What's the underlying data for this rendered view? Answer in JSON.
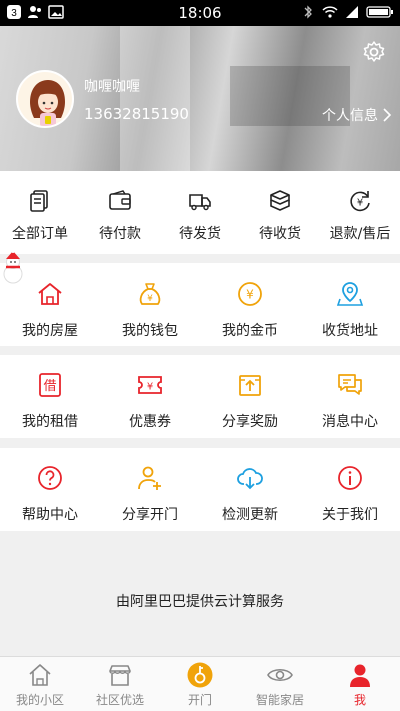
{
  "statusbar": {
    "time": "18:06",
    "notif_count": "3"
  },
  "header": {
    "username": "咖喱咖喱",
    "phone": "13632815190",
    "profile_link": "个人信息"
  },
  "orders": [
    {
      "label": "全部订单",
      "icon": "order-list-icon"
    },
    {
      "label": "待付款",
      "icon": "wallet-icon"
    },
    {
      "label": "待发货",
      "icon": "truck-icon"
    },
    {
      "label": "待收货",
      "icon": "package-icon"
    },
    {
      "label": "退款/售后",
      "icon": "refund-icon"
    }
  ],
  "grid1": [
    {
      "label": "我的房屋",
      "icon": "house-icon",
      "color": "#e8242b"
    },
    {
      "label": "我的钱包",
      "icon": "money-bag-icon",
      "color": "#f0a30a"
    },
    {
      "label": "我的金币",
      "icon": "coin-icon",
      "color": "#f0a30a"
    },
    {
      "label": "收货地址",
      "icon": "map-pin-icon",
      "color": "#1ea0e0"
    }
  ],
  "grid2": [
    {
      "label": "我的租借",
      "icon": "borrow-icon",
      "glyph": "借",
      "color": "#e8242b"
    },
    {
      "label": "优惠券",
      "icon": "coupon-icon",
      "color": "#e8242b"
    },
    {
      "label": "分享奖励",
      "icon": "share-reward-icon",
      "color": "#f0a30a"
    },
    {
      "label": "消息中心",
      "icon": "message-icon",
      "color": "#f0a30a"
    }
  ],
  "grid3": [
    {
      "label": "帮助中心",
      "icon": "help-icon",
      "color": "#e8242b"
    },
    {
      "label": "分享开门",
      "icon": "add-user-icon",
      "color": "#f0a30a"
    },
    {
      "label": "检测更新",
      "icon": "cloud-download-icon",
      "color": "#1ea0e0"
    },
    {
      "label": "关于我们",
      "icon": "info-icon",
      "color": "#e8242b"
    }
  ],
  "footer_text": "由阿里巴巴提供云计算服务",
  "tabs": [
    {
      "label": "我的小区",
      "icon": "home-tab-icon",
      "active": false
    },
    {
      "label": "社区优选",
      "icon": "shop-tab-icon",
      "active": false
    },
    {
      "label": "开门",
      "icon": "door-key-tab-icon",
      "active": false
    },
    {
      "label": "智能家居",
      "icon": "eye-tab-icon",
      "active": false
    },
    {
      "label": "我",
      "icon": "person-tab-icon",
      "active": true
    }
  ],
  "colors": {
    "accent_red": "#e8242b",
    "accent_orange": "#f0a30a",
    "accent_blue": "#1ea0e0"
  }
}
